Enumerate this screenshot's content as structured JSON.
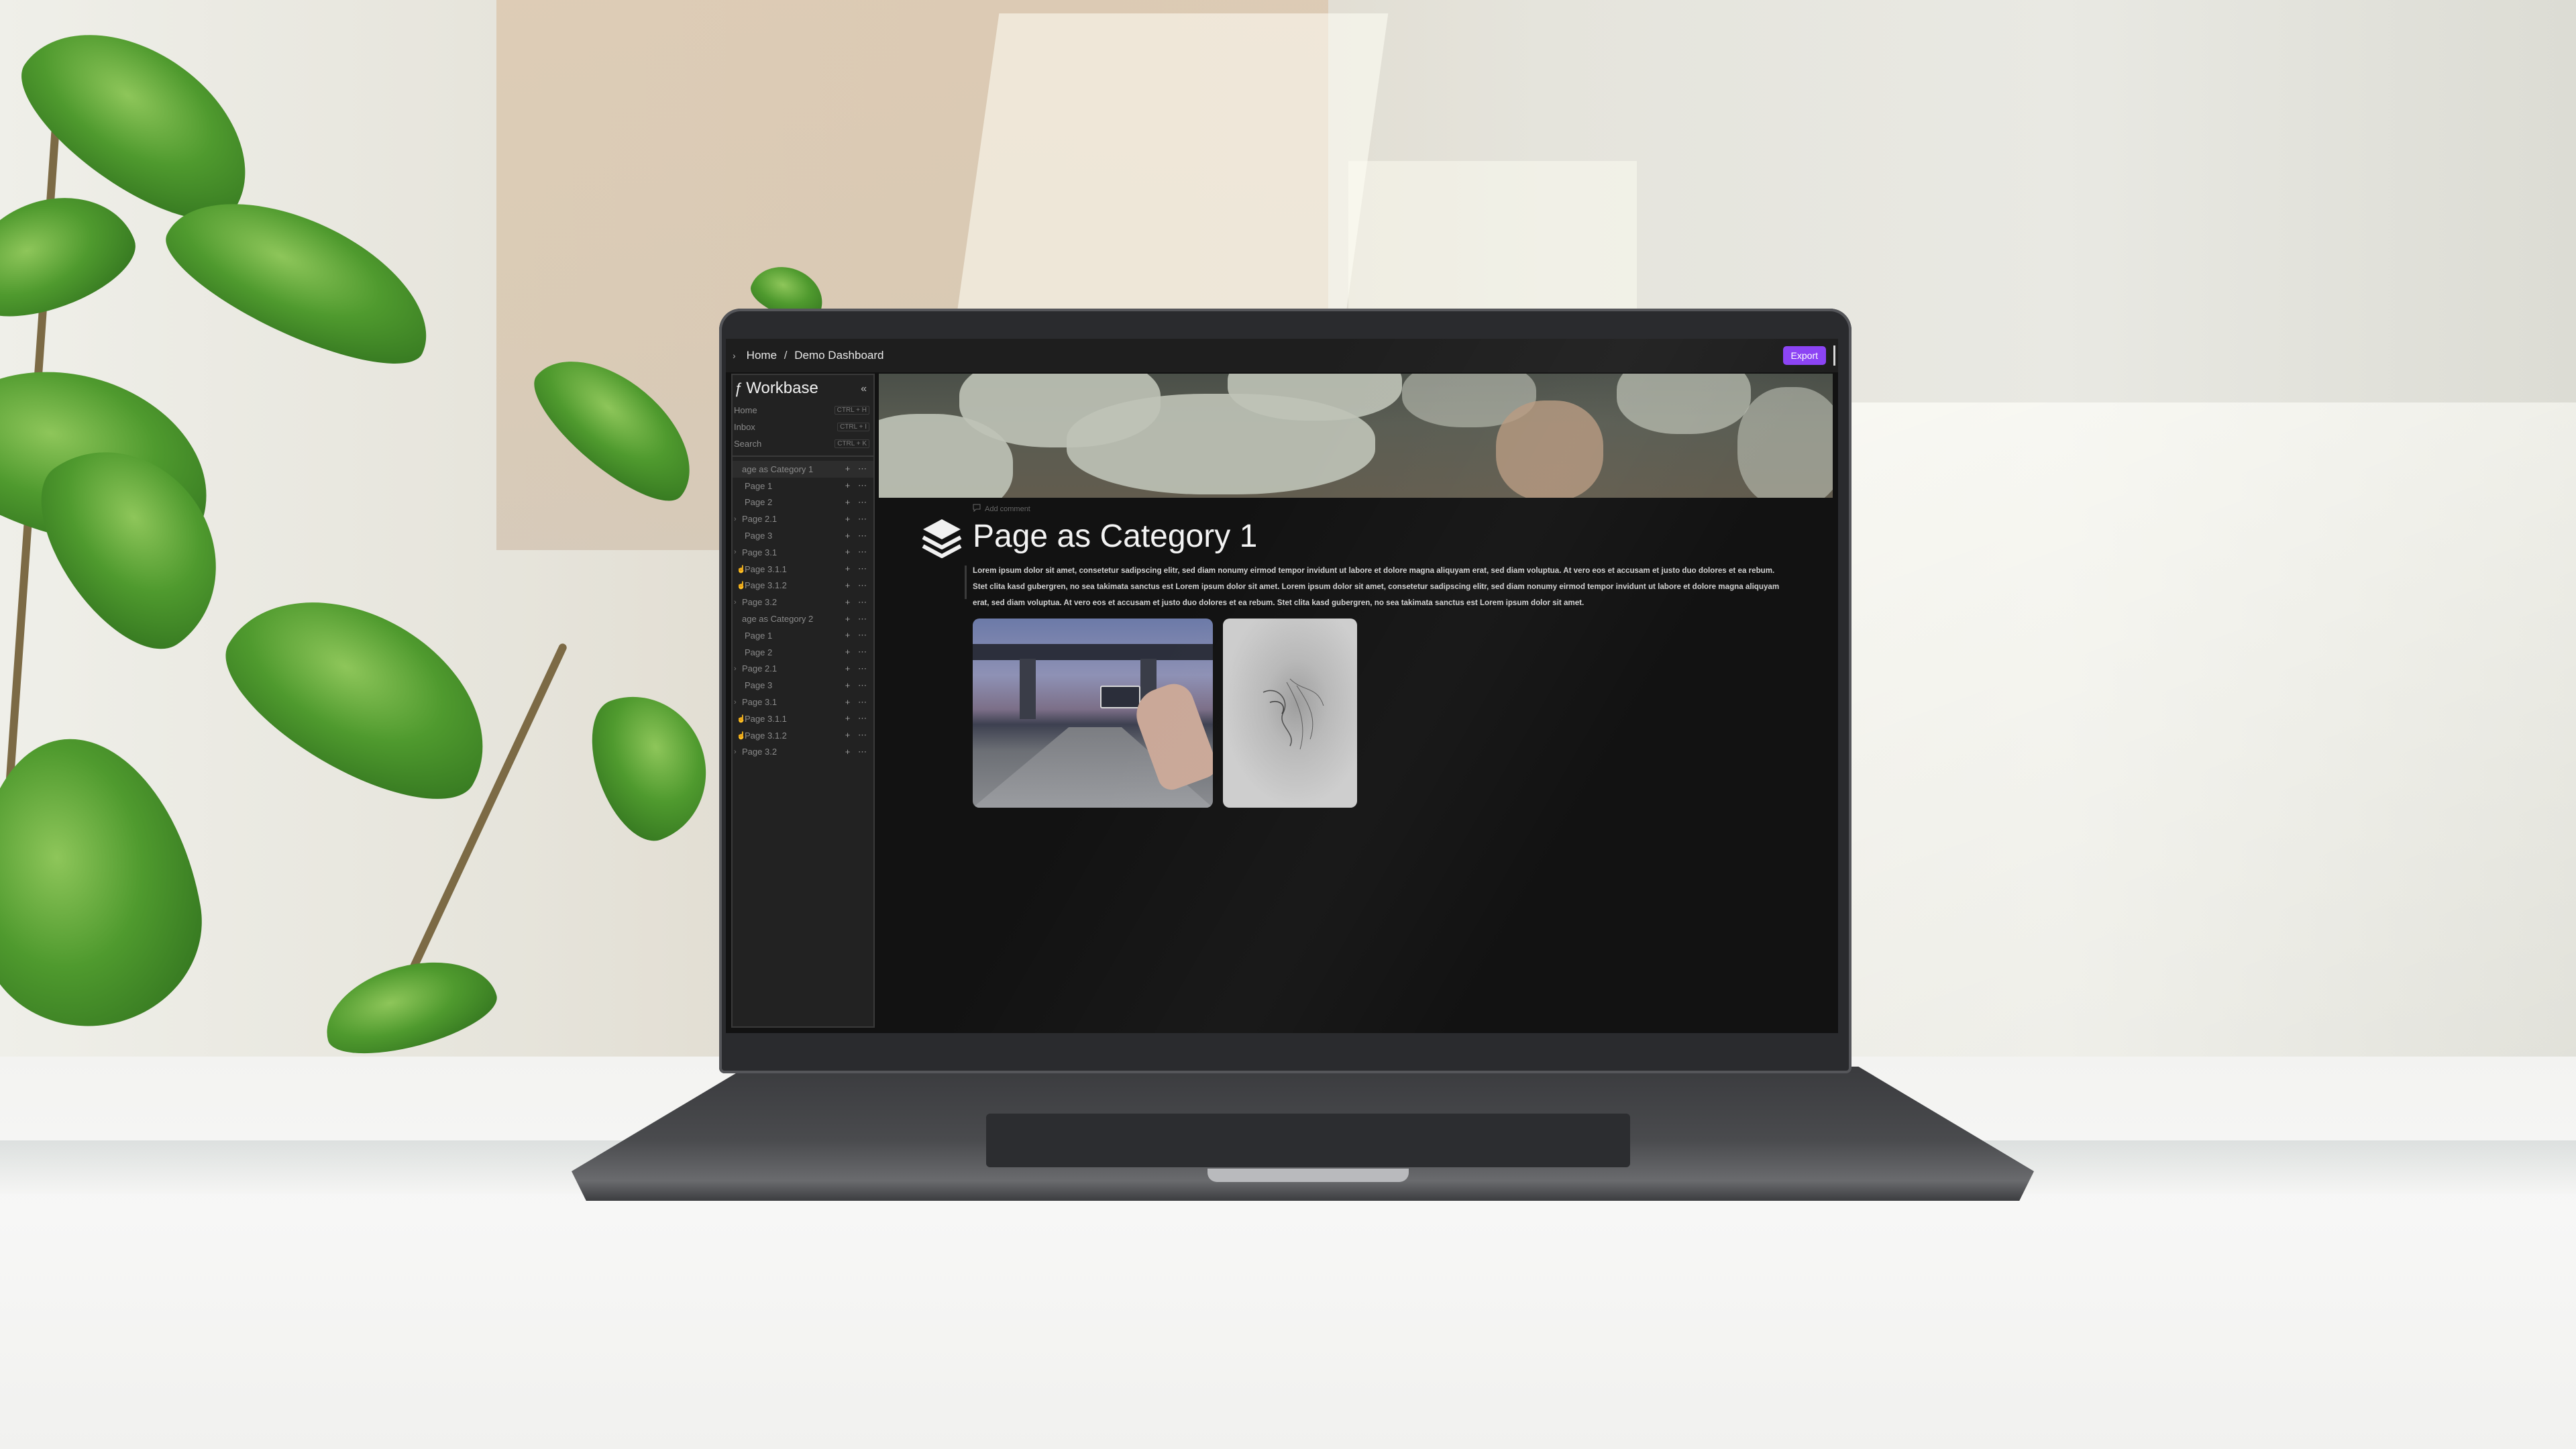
{
  "topbar": {
    "breadcrumb": [
      "Home",
      "Demo Dashboard"
    ],
    "breadcrumb_sep": "/",
    "export_label": "Export"
  },
  "sidebar": {
    "workspace_name": "Workbase",
    "quick_nav": [
      {
        "label": "Home",
        "shortcut": "CTRL + H"
      },
      {
        "label": "Inbox",
        "shortcut": "CTRL + I"
      },
      {
        "label": "Search",
        "shortcut": "CTRL + K"
      }
    ],
    "tree": [
      {
        "label": "age as Category 1",
        "indent": 0,
        "glyph": "",
        "active": true
      },
      {
        "label": "Page 1",
        "indent": 1,
        "glyph": ""
      },
      {
        "label": "Page 2",
        "indent": 1,
        "glyph": ""
      },
      {
        "label": "Page 2.1",
        "indent": 0,
        "glyph": "›"
      },
      {
        "label": "Page 3",
        "indent": 1,
        "glyph": ""
      },
      {
        "label": "Page 3.1",
        "indent": 0,
        "glyph": "›"
      },
      {
        "label": "Page 3.1.1",
        "indent": 1,
        "glyph": "☝"
      },
      {
        "label": "Page 3.1.2",
        "indent": 1,
        "glyph": "☝"
      },
      {
        "label": "Page 3.2",
        "indent": 0,
        "glyph": "›"
      },
      {
        "label": "age as Category 2",
        "indent": 0,
        "glyph": ""
      },
      {
        "label": "Page 1",
        "indent": 1,
        "glyph": ""
      },
      {
        "label": "Page 2",
        "indent": 1,
        "glyph": ""
      },
      {
        "label": "Page 2.1",
        "indent": 0,
        "glyph": "›"
      },
      {
        "label": "Page 3",
        "indent": 1,
        "glyph": ""
      },
      {
        "label": "Page 3.1",
        "indent": 0,
        "glyph": "›"
      },
      {
        "label": "Page 3.1.1",
        "indent": 1,
        "glyph": "☝"
      },
      {
        "label": "Page 3.1.2",
        "indent": 1,
        "glyph": "☝"
      },
      {
        "label": "Page 3.2",
        "indent": 0,
        "glyph": "›"
      }
    ],
    "item_actions": "+ ⋯"
  },
  "page": {
    "add_comment": "Add comment",
    "title": "Page as Category  1",
    "body": "Lorem ipsum dolor sit amet, consetetur sadipscing elitr, sed diam nonumy eirmod tempor invidunt ut labore et dolore magna aliquyam erat, sed diam voluptua. At vero eos et accusam et justo duo dolores et ea rebum. Stet clita kasd gubergren, no sea takimata sanctus est Lorem ipsum dolor sit amet. Lorem ipsum dolor sit amet, consetetur sadipscing elitr, sed diam nonumy eirmod tempor invidunt ut labore et dolore magna aliquyam erat, sed diam voluptua. At vero eos et accusam et justo duo dolores et ea rebum. Stet clita kasd gubergren, no sea takimata sanctus est Lorem ipsum dolor sit amet.",
    "icons": {
      "page_icon": "layers-icon",
      "comment_icon": "comment-icon"
    }
  },
  "colors": {
    "accent": "#8b43f4",
    "background": "#121212",
    "sidebar": "#222222"
  }
}
